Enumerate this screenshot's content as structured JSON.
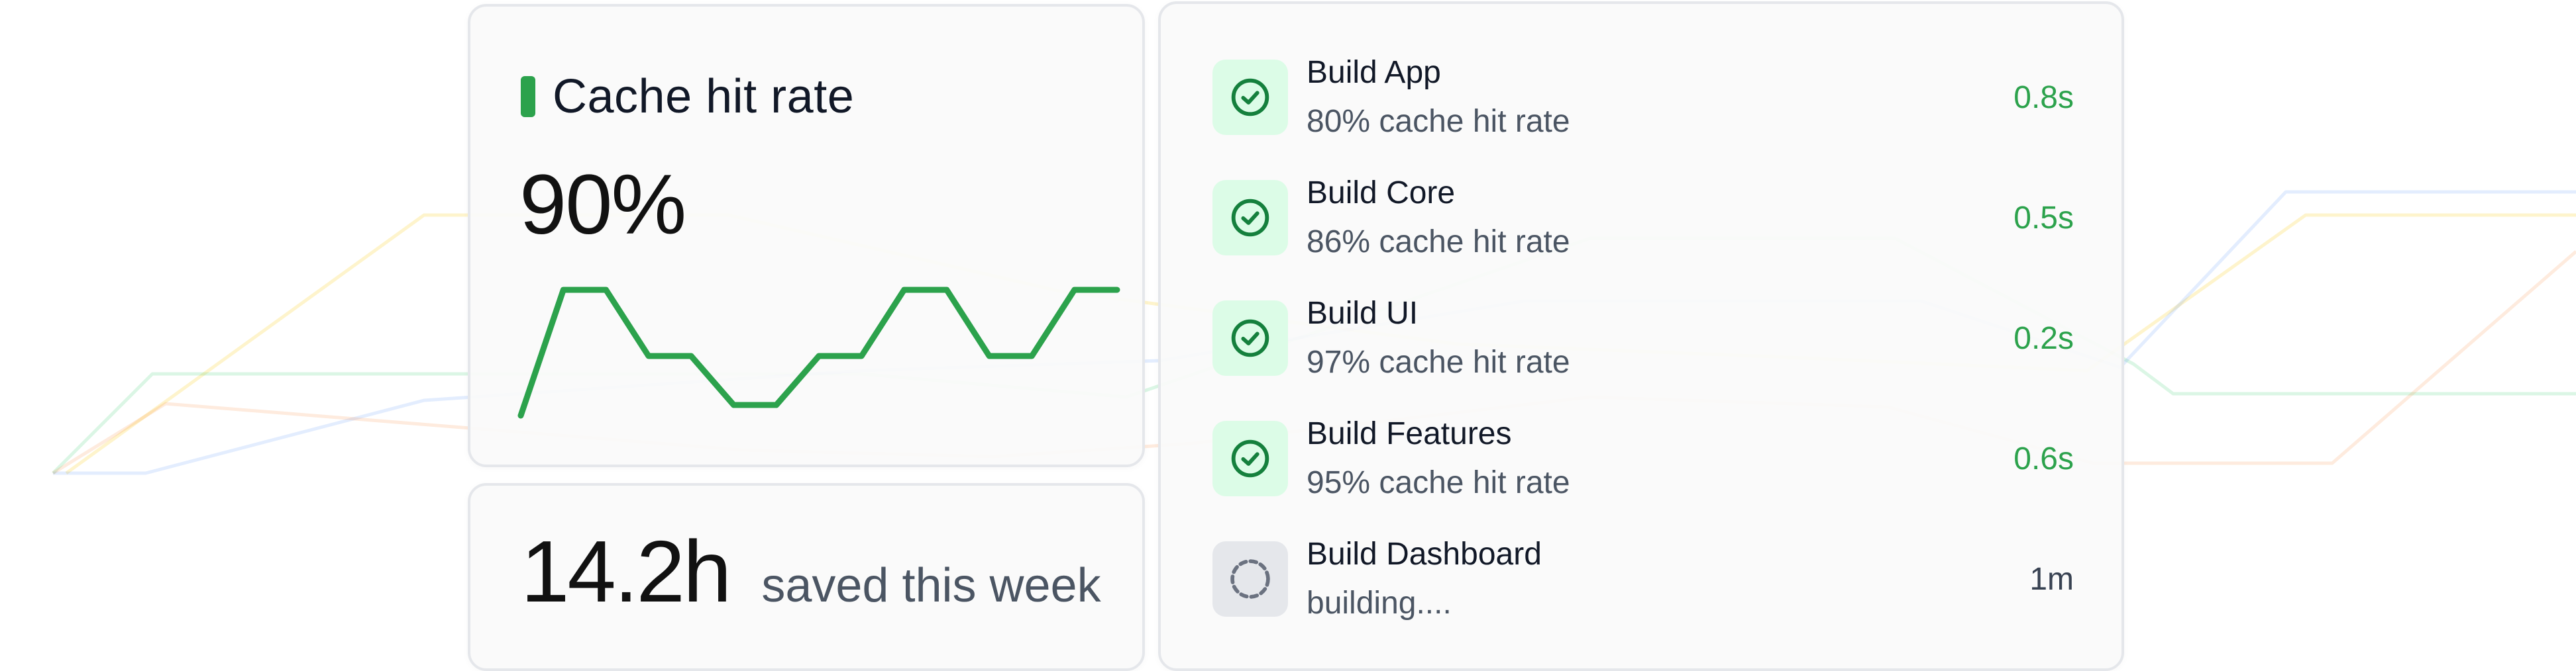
{
  "colors": {
    "accent_green": "#2ca24c",
    "success_bg": "#dcfce7",
    "success_icon": "#15803d",
    "pending_bg": "#e5e7eb",
    "pending_icon": "#6b7280",
    "text_primary": "#111827",
    "text_secondary": "#4b5563"
  },
  "cache_card": {
    "title": "Cache hit rate",
    "value": "90%",
    "legend_color": "#2ca24c",
    "sparkline": [
      0.05,
      1.0,
      1.0,
      0.5,
      0.5,
      0.13,
      0.13,
      0.5,
      0.5,
      1.0,
      1.0,
      0.5,
      0.5,
      1.0,
      1.0
    ]
  },
  "saved_card": {
    "value": "14.2h",
    "label": "saved this week"
  },
  "builds": [
    {
      "name": "Build App",
      "detail": "80% cache hit rate",
      "time": "0.8s",
      "status": "done",
      "icon": "check-circle-icon"
    },
    {
      "name": "Build Core",
      "detail": "86% cache hit rate",
      "time": "0.5s",
      "status": "done",
      "icon": "check-circle-icon"
    },
    {
      "name": "Build UI",
      "detail": "97% cache hit rate",
      "time": "0.2s",
      "status": "done",
      "icon": "check-circle-icon"
    },
    {
      "name": "Build Features",
      "detail": "95% cache hit rate",
      "time": "0.6s",
      "status": "done",
      "icon": "check-circle-icon"
    },
    {
      "name": "Build Dashboard",
      "detail": "building....",
      "time": "1m",
      "status": "building",
      "icon": "dashed-circle-icon"
    }
  ]
}
